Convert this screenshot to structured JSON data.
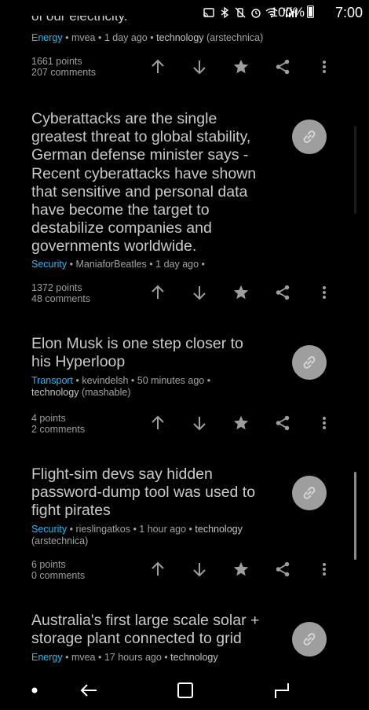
{
  "status_bar": {
    "battery": "100%",
    "time": "7:00",
    "icons": [
      "cast-icon",
      "bluetooth-icon",
      "vibrate-mute-icon",
      "alarm-icon",
      "wifi-icon",
      "lte-signal-icon"
    ]
  },
  "feed": {
    "items": [
      {
        "title": "",
        "category": "Energy",
        "submitter": "mvea",
        "age": "1 day ago",
        "tag": "technology",
        "source": "(arstechnica)",
        "points": "1661 points",
        "comments": "207 comments"
      },
      {
        "title": "Cyberattacks are the single greatest threat to global stability, German defense minister says - Recent cyberattacks have shown that sensitive and personal data have become the target to destabilize companies and governments worldwide.",
        "category": "Security",
        "submitter": "ManiaforBeatles",
        "age": "1 day ago",
        "tag": "",
        "source": "",
        "points": "1372 points",
        "comments": "48 comments"
      },
      {
        "title": "Elon Musk is one step closer to his Hyperloop",
        "category": "Transport",
        "submitter": "kevindelsh",
        "age": "50 minutes ago",
        "tag": "technology",
        "source": "(mashable)",
        "points": "4 points",
        "comments": "2 comments"
      },
      {
        "title": "Flight-sim devs say hidden password-dump tool was used to fight pirates",
        "category": "Security",
        "submitter": "rieslingatkos",
        "age": "1 hour ago",
        "tag": "technology",
        "source": "(arstechnica)",
        "points": "6 points",
        "comments": "0 comments"
      },
      {
        "title": "Australia's first large scale solar + storage plant connected to grid",
        "category": "Energy",
        "submitter": "mvea",
        "age": "17 hours ago",
        "tag": "technology",
        "source": "",
        "points": "",
        "comments": ""
      }
    ]
  },
  "actions": [
    "upvote-icon",
    "downvote-icon",
    "save-star-icon",
    "share-icon",
    "more-options-icon"
  ],
  "colors": {
    "category": "#29b6f6",
    "background": "#000000",
    "title": "#c9c9c9",
    "link_button": "#9e9e9e"
  }
}
